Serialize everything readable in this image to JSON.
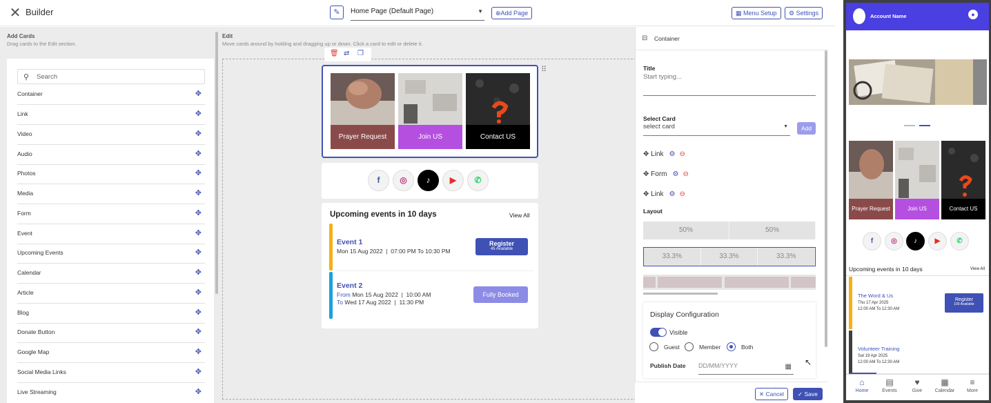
{
  "header": {
    "title": "Builder",
    "page_select": "Home Page (Default Page)",
    "add_page": "Add Page",
    "menu_setup": "Menu Setup",
    "settings": "Settings"
  },
  "add_cards": {
    "heading": "Add Cards",
    "subtitle": "Drag cards to the Edit section.",
    "search_placeholder": "Search",
    "items": [
      "Container",
      "Link",
      "Video",
      "Audio",
      "Photos",
      "Media",
      "Form",
      "Event",
      "Upcoming Events",
      "Calendar",
      "Article",
      "Blog",
      "Donate Button",
      "Google Map",
      "Social Media Links",
      "Live Streaming"
    ]
  },
  "edit": {
    "heading": "Edit",
    "subtitle": "Move cards around by holding and dragging up or down. Click a card to edit or delete it.",
    "tiles": [
      "Prayer Request",
      "Join US",
      "Contact US"
    ],
    "events": {
      "heading": "Upcoming events in 10 days",
      "view_all": "View All",
      "e1": {
        "name": "Event 1",
        "date": "Mon 15 Aug  2022",
        "time": "07:00 PM To 10:30 PM",
        "btn": "Register",
        "btn_sub": "45 Available"
      },
      "e2": {
        "name": "Event 2",
        "from_label": "From",
        "from_date": "Mon 15 Aug  2022",
        "from_time": "10:00 AM",
        "to_label": "To",
        "to_date": "Wed 17 Aug  2022",
        "to_time": "11:30 PM",
        "btn": "Fully Booked"
      }
    }
  },
  "properties": {
    "panel_title": "Container",
    "title_label": "Title",
    "title_placeholder": "Start typing...",
    "select_card_label": "Select Card",
    "select_card_value": "select card",
    "add_btn": "Add",
    "rows": [
      "Link",
      "Form",
      "Link"
    ],
    "layout_label": "Layout",
    "layout_two": [
      "50%",
      "50%"
    ],
    "layout_three": [
      "33.3%",
      "33.3%",
      "33.3%"
    ],
    "display_config": "Display Configuration",
    "visible": "Visible",
    "audience": [
      "Guest",
      "Member",
      "Both"
    ],
    "audience_selected": "Both",
    "publish_label": "Publish Date",
    "publish_placeholder": "DD/MM/YYYY",
    "cancel": "Cancel",
    "save": "Save"
  },
  "preview": {
    "account": "Account Name",
    "tiles": [
      "Prayer Request",
      "Join US",
      "Contact US"
    ],
    "events_heading": "Upcoming events in 10 days",
    "view_all": "View All",
    "e1": {
      "name": "The Word & Us",
      "date": "Thu 17 Apr  2025",
      "time": "12:00 AM To 12:30 AM",
      "btn": "Register",
      "btn_sub": "100 Available"
    },
    "e2": {
      "name": "Volunteer Training",
      "date": "Sat 19 Apr  2025",
      "time": "12:00 AM To 12:30 AM"
    },
    "nav": [
      "Home",
      "Events",
      "Give",
      "Calendar",
      "More"
    ]
  },
  "colors": {
    "accent": "#3f51b5",
    "prayer": "#8b4a4a",
    "join": "#b44fe0",
    "contact": "#000000",
    "event_yellow": "#f5b014",
    "event_blue": "#1aa0e0",
    "phone_header": "#4a3fe0"
  },
  "icons": [
    "close-icon",
    "pencil-icon",
    "plus-icon",
    "grid-icon",
    "gear-icon",
    "search-icon",
    "move-icon",
    "trash-icon",
    "swap-icon",
    "copy-icon",
    "facebook-icon",
    "instagram-icon",
    "tiktok-icon",
    "youtube-icon",
    "whatsapp-icon",
    "calendar-icon",
    "user-icon",
    "home-icon"
  ]
}
